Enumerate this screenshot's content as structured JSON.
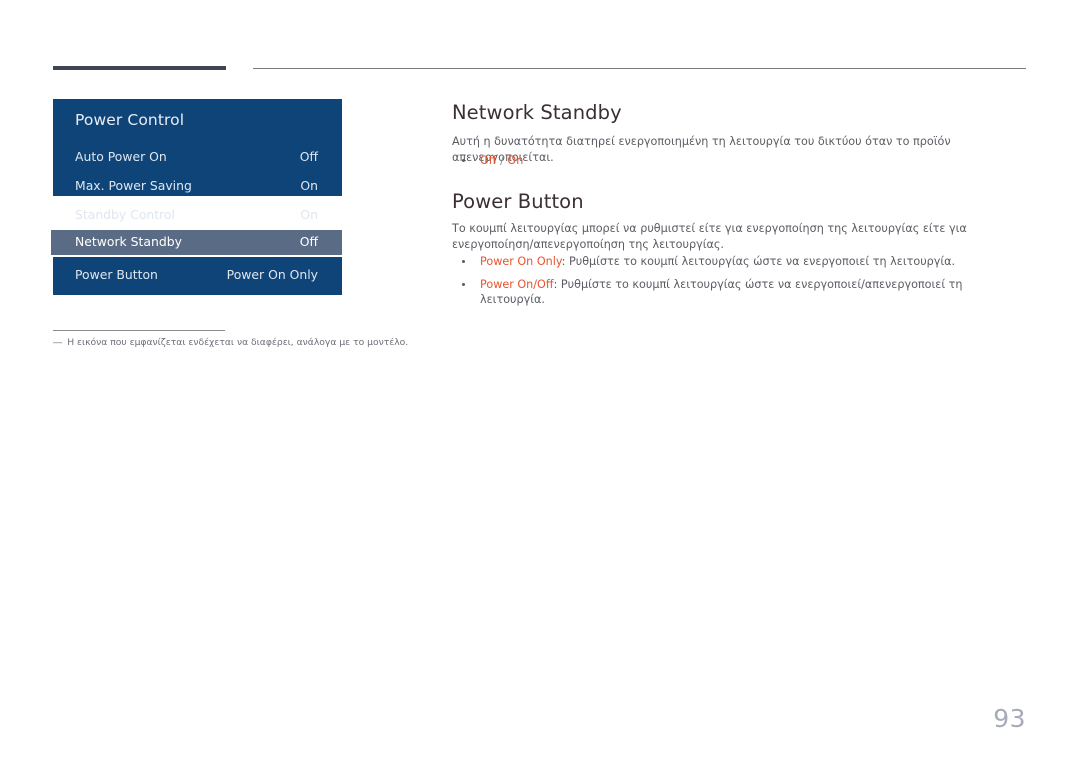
{
  "page": {
    "number": "93"
  },
  "osd": {
    "title": "Power Control",
    "rows": [
      {
        "label": "Auto Power On",
        "value": "Off"
      },
      {
        "label": "Max. Power Saving",
        "value": "On"
      },
      {
        "label": "Standby Control",
        "value": "On"
      },
      {
        "label": "Network Standby",
        "value": "Off"
      },
      {
        "label": "Power Button",
        "value": "Power On Only"
      }
    ],
    "selected_index": 3,
    "colors": {
      "panel": "#0f4479",
      "selected_row": "#5a6c85",
      "text": "#dfe6ee"
    }
  },
  "footnote": {
    "dash": "―",
    "text": "Η εικόνα που εμφανίζεται ενδέχεται να διαφέρει, ανάλογα με το μοντέλο."
  },
  "sections": [
    {
      "heading": "Network Standby",
      "body": "Αυτή η δυνατότητα διατηρεί ενεργοποιημένη τη λειτουργία του δικτύου όταν το προϊόν απενεργοποιείται.",
      "bullets": [
        {
          "option": "Off",
          "separator": " / ",
          "option2": "On",
          "desc": ""
        }
      ]
    },
    {
      "heading": "Power Button",
      "body": "Το κουμπί λειτουργίας μπορεί να ρυθμιστεί είτε για ενεργοποίηση της λειτουργίας είτε για ενεργοποίηση/απενεργοποίηση της λειτουργίας.",
      "bullets": [
        {
          "option": "Power On Only",
          "desc": ": Ρυθμίστε το κουμπί λειτουργίας ώστε να ενεργοποιεί τη λειτουργία."
        },
        {
          "option": "Power On/Off",
          "desc": ": Ρυθμίστε το κουμπί λειτουργίας ώστε να ενεργοποιεί/απενεργοποιεί τη λειτουργία."
        }
      ]
    }
  ],
  "colors": {
    "accent": "#e8542f",
    "heading": "#3b2f35",
    "body": "#5b5b63",
    "rule_dark": "#3f4457",
    "page_number": "#a7abb8"
  }
}
